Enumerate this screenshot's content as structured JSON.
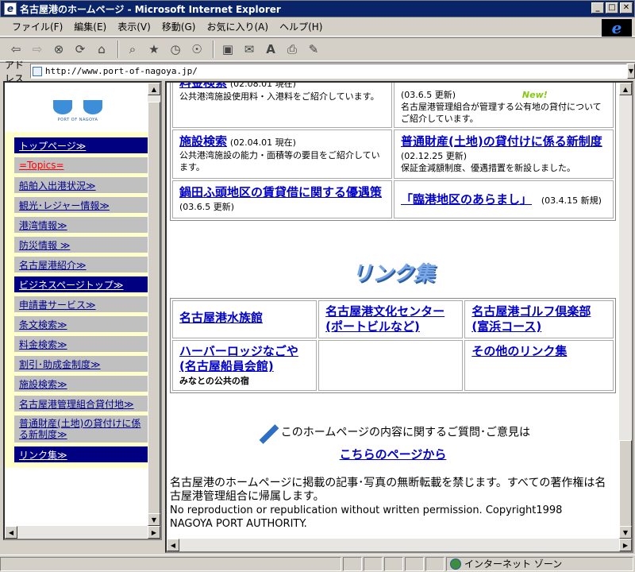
{
  "window": {
    "title": "名古屋港のホームページ - Microsoft Internet Explorer",
    "app_icon": "e",
    "controls": [
      "minimize-icon",
      "maximize-icon",
      "close-icon"
    ]
  },
  "menu": [
    "ファイル(F)",
    "編集(E)",
    "表示(V)",
    "移動(G)",
    "お気に入り(A)",
    "ヘルプ(H)"
  ],
  "toolbar": {
    "icons": [
      "back-icon",
      "forward-icon",
      "stop-icon",
      "refresh-icon",
      "home-icon",
      "search-icon",
      "favorites-icon",
      "history-icon",
      "channels-icon",
      "fullscreen-icon",
      "mail-icon",
      "font-icon",
      "print-icon",
      "edit-icon"
    ]
  },
  "address": {
    "label": "アドレス",
    "url": "http://www.port-of-nagoya.jp/"
  },
  "logo": {
    "text": "PORT OF NAGOYA"
  },
  "nav": [
    "トップページ≫",
    "=Topics=",
    "船舶入出港状況≫",
    "観光･レジャー情報≫",
    "港湾情報≫",
    "防災情報 ≫",
    "名古屋港紹介≫",
    "ビジネスページトップ≫",
    "申請書サービス≫",
    "条文検索≫",
    "料金検索≫",
    "割引･助成金制度≫",
    "施設検索≫",
    "名古屋港管理組合貸付地≫",
    "普通財産(土地)の貸付けに係る新制度≫",
    "リンク集≫"
  ],
  "services": {
    "row1_left_title": "料金検索",
    "row1_left_date": "(02.08.01 現在)",
    "row1_left_desc": "公共港湾施設使用料・入港料をご紹介しています。",
    "row1_right_date": "(03.6.5 更新)",
    "row1_right_badge": "New!",
    "row1_right_desc": "名古屋港管理組合が管理する公有地の貸付についてご紹介しています。",
    "row2_left_title": "施設検索",
    "row2_left_date": "(02.04.01 現在)",
    "row2_left_desc": "公共港湾施設の能力・面積等の要目をご紹介しています。",
    "row2_right_title": "普通財産(土地)の貸付けに係る新制度",
    "row2_right_date": "(02.12.25 更新)",
    "row2_right_desc": "保証金減額制度、優遇措置を新設しました。",
    "row3_left_title": "鍋田ふ頭地区の賃貸借に関する優遇策",
    "row3_left_date": "(03.6.5 更新)",
    "row3_right_title": "「臨港地区のあらまし」",
    "row3_right_date": "(03.4.15 新規)"
  },
  "links_heading": "リンク集",
  "links": {
    "aquarium": "名古屋港水族館",
    "culture_center": "名古屋港文化センター(ポートビルなど)",
    "golf": "名古屋港ゴルフ倶楽部(富浜コース)",
    "harbor_lodge": "ハーバーロッジなごや(名古屋船員会館)",
    "harbor_lodge_sub": "みなとの公共の宿",
    "other": "その他のリンク集"
  },
  "inquiry": {
    "text": "このホームページの内容に関するご質問･ご意見は",
    "link": "こちらのページから"
  },
  "footer": {
    "jp": "名古屋港のホームページに掲載の記事･写真の無断転載を禁じます。すべての著作権は名古屋港管理組合に帰属します。",
    "en1": "No reproduction or republication without written permission. Copyright1998",
    "en2": "NAGOYA PORT AUTHORITY."
  },
  "status": {
    "zone": "インターネット ゾーン"
  }
}
